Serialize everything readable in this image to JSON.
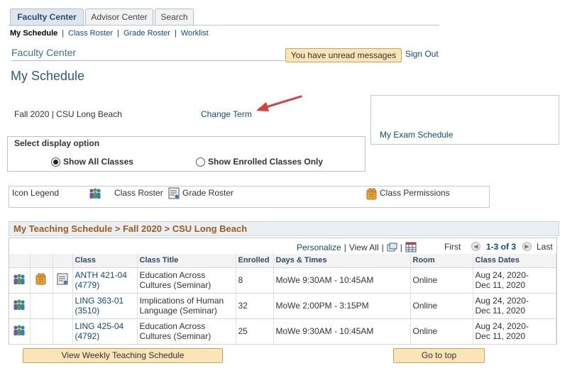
{
  "tabs": [
    {
      "label": "Faculty Center",
      "active": true
    },
    {
      "label": "Advisor Center",
      "active": false
    },
    {
      "label": "Search",
      "active": false
    }
  ],
  "subnav": {
    "current": "My Schedule",
    "links": [
      "Class Roster",
      "Grade Roster",
      "Worklist"
    ],
    "separator": "|"
  },
  "header": {
    "section": "Faculty Center",
    "messages_button": "You have unread messages",
    "sign_out": "Sign Out"
  },
  "page": {
    "title": "My Schedule",
    "term": "Fall 2020 | CSU Long Beach",
    "change_term": "Change Term",
    "exam_schedule": "My Exam Schedule"
  },
  "display_option": {
    "title": "Select display option",
    "options": [
      {
        "label": "Show All Classes",
        "selected": true
      },
      {
        "label": "Show Enrolled Classes Only",
        "selected": false
      }
    ]
  },
  "legend": {
    "title": "Icon Legend",
    "items": [
      {
        "icon": "class-roster-icon",
        "label": "Class Roster"
      },
      {
        "icon": "grade-roster-icon",
        "label": "Grade Roster"
      },
      {
        "icon": "class-permissions-icon",
        "label": "Class Permissions"
      }
    ]
  },
  "schedule": {
    "header": "My Teaching Schedule > Fall 2020 > CSU Long Beach",
    "toolbar": {
      "personalize": "Personalize",
      "view_all": "View All",
      "first": "First",
      "range": "1-3 of 3",
      "last": "Last",
      "separator": "|"
    },
    "columns": [
      "",
      "",
      "",
      "Class",
      "Class Title",
      "Enrolled",
      "Days & Times",
      "Room",
      "Class Dates"
    ],
    "rows": [
      {
        "class_line1": "ANTH 421-04",
        "class_line2": "(4779)",
        "title_line1": "Education Across",
        "title_line2": "Cultures (Seminar)",
        "enrolled": "8",
        "days_times": "MoWe 9:30AM - 10:45AM",
        "room": "Online",
        "dates_line1": "Aug 24, 2020-",
        "dates_line2": "Dec 11, 2020",
        "permissions": true,
        "grade_roster": true
      },
      {
        "class_line1": "LING 363-01",
        "class_line2": "(3510)",
        "title_line1": "Implications of Human",
        "title_line2": "Language (Seminar)",
        "enrolled": "32",
        "days_times": "MoWe 2:00PM - 3:15PM",
        "room": "Online",
        "dates_line1": "Aug 24, 2020-",
        "dates_line2": "Dec 11, 2020",
        "permissions": false,
        "grade_roster": false
      },
      {
        "class_line1": "LING 425-04",
        "class_line2": "(4792)",
        "title_line1": "Education Across",
        "title_line2": "Cultures (Seminar)",
        "enrolled": "25",
        "days_times": "MoWe 9:30AM - 10:45AM",
        "room": "Online",
        "dates_line1": "Aug 24, 2020-",
        "dates_line2": "Dec 11, 2020",
        "permissions": false,
        "grade_roster": false
      }
    ]
  },
  "buttons": {
    "weekly": "View Weekly Teaching Schedule",
    "top": "Go to top"
  },
  "colors": {
    "link": "#0d4a8a",
    "button_bg": "#fbe4b6",
    "schedule_header": "#a05c1b",
    "annotation_arrow": "#e03a3a"
  }
}
